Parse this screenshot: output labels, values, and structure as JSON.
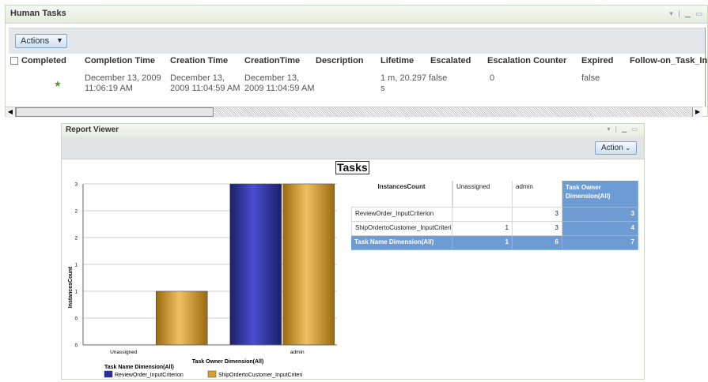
{
  "human_tasks": {
    "title": "Human Tasks",
    "window_controls": "▾ | ▁ ▭",
    "actions_label": "Actions",
    "columns": [
      "Completed",
      "Completion Time",
      "Creation Time",
      "CreationTime",
      "Description",
      "Lifetime",
      "Escalated",
      "Escalation Counter",
      "Expired",
      "Follow-on_Task_In"
    ],
    "row": {
      "completion_time": "December 13, 2009 11:06:19 AM",
      "completion_time_l1": "December 13, 2009",
      "completion_time_l2": "11:06:19 AM",
      "creation_time_l1": "December 13,",
      "creation_time_l2": "2009 11:04:59 AM",
      "creationtime_l1": "December 13,",
      "creationtime_l2": "2009 11:04:59 AM",
      "lifetime_l1": "1 m, 20.297",
      "lifetime_l2": "s",
      "escalated": "false",
      "escalation_counter": "0",
      "expired": "false"
    }
  },
  "report_viewer": {
    "title": "Report Viewer",
    "window_controls": "▾ | ▁ ▭",
    "action_label": "Action",
    "report_title": "Tasks",
    "crosstab": {
      "corner": "InstancesCount",
      "col_headers": [
        "Unassigned",
        "admin"
      ],
      "total_col_l1": "Task Owner",
      "total_col_l2": "Dimension(All)",
      "rows": [
        {
          "label": "ReviewOrder_InputCriterion",
          "values": [
            "",
            "3"
          ],
          "total": "3"
        },
        {
          "label": "ShipOrdertoCustomer_InputCriteri",
          "values": [
            "1",
            "3"
          ],
          "total": "4"
        }
      ],
      "total_row": {
        "label": "Task Name Dimension(All)",
        "values": [
          "1",
          "6"
        ],
        "total": "7"
      }
    }
  },
  "chart_data": {
    "type": "bar",
    "title": "",
    "xlabel": "Task Owner Dimension(All)",
    "ylabel": "InstancesCount",
    "categories": [
      "Unassigned",
      "admin"
    ],
    "ytick_labels": [
      "0",
      "0",
      "1",
      "1",
      "2",
      "2",
      "3"
    ],
    "ylim": [
      0,
      3
    ],
    "legend_title": "Task Name Dimension(All)",
    "series": [
      {
        "name": "ReviewOrder_InputCriterion",
        "values": [
          0,
          3
        ],
        "color": "#2b2f9c"
      },
      {
        "name": "ShipOrdertoCustomer_InputCriteri",
        "values": [
          1,
          3
        ],
        "color": "#d9a030"
      }
    ]
  }
}
